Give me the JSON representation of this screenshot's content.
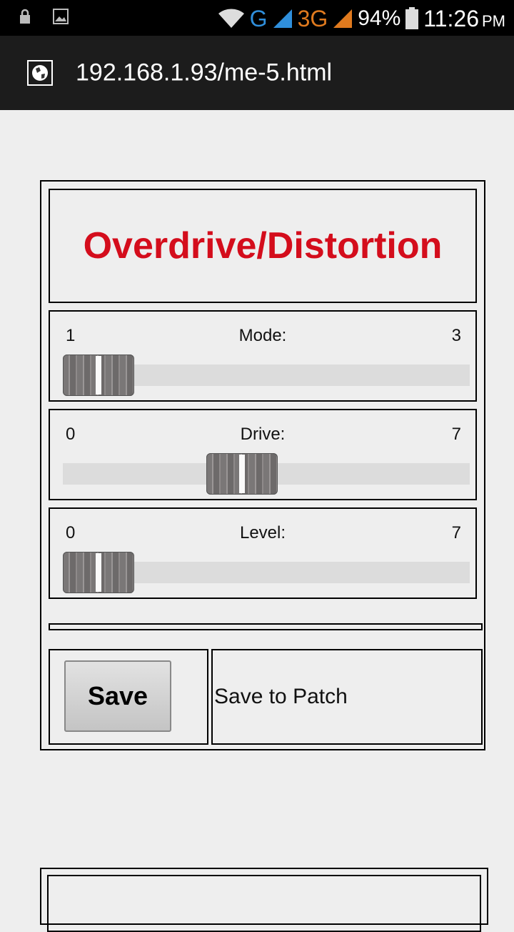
{
  "status_bar": {
    "network_g": "G",
    "network_3g": "3G",
    "battery": "94%",
    "time": "11:26",
    "ampm": "PM"
  },
  "url_bar": {
    "url": "192.168.1.93/me-5.html"
  },
  "effect": {
    "title": "Overdrive/Distortion",
    "title_color": "#d40d1c"
  },
  "sliders": [
    {
      "label": "Mode:",
      "min": "1",
      "max": "3",
      "value": 1
    },
    {
      "label": "Drive:",
      "min": "0",
      "max": "7",
      "value": 3
    },
    {
      "label": "Level:",
      "min": "0",
      "max": "7",
      "value": 0
    }
  ],
  "actions": {
    "save_button": "Save",
    "save_label": "Save to Patch"
  }
}
